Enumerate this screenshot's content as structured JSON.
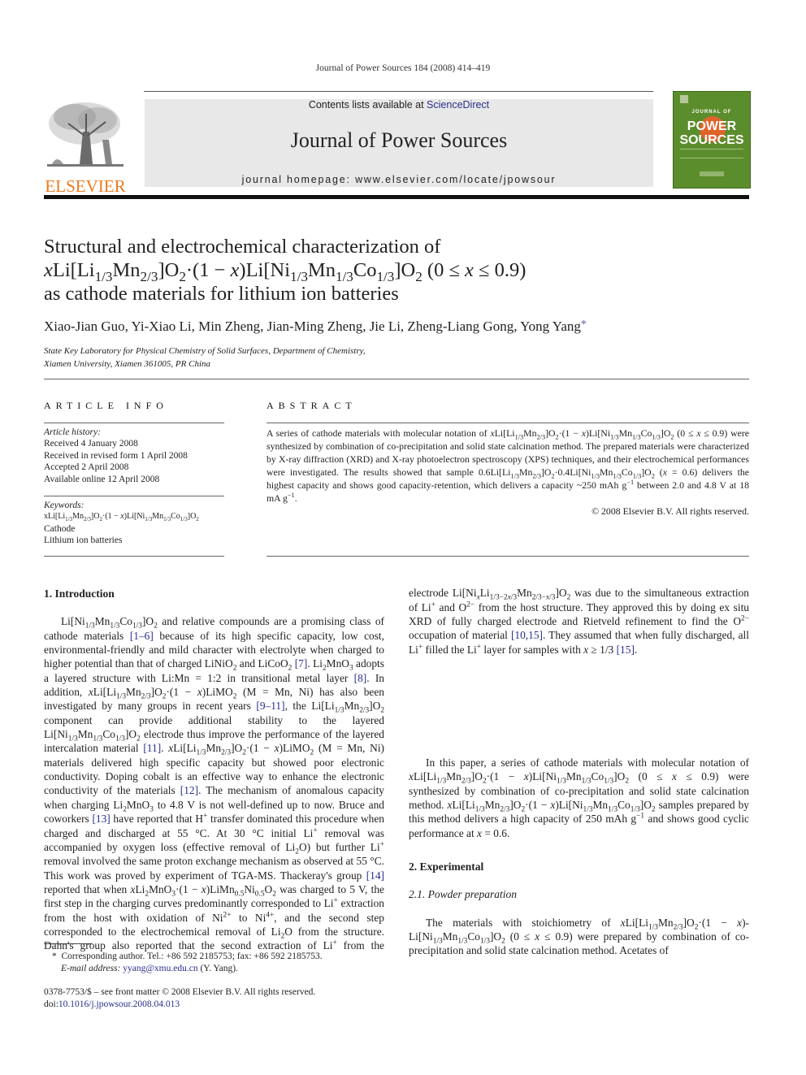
{
  "running_head": "Journal of Power Sources 184 (2008) 414–419",
  "header": {
    "publisher_logo_text": "ELSEVIER",
    "contents_prefix": "Contents lists available at ",
    "contents_link": "ScienceDirect",
    "journal_name": "Journal of Power Sources",
    "homepage_prefix": "journal homepage: ",
    "homepage_url": "www.elsevier.com/locate/jpowsour",
    "cover_small": "JOURNAL OF",
    "cover_big_1": "POWER",
    "cover_big_2": "SOURCES",
    "colors": {
      "elsevier_orange": "#f07a1e",
      "cover_green": "#5c8d2c",
      "cover_sun": "#e0632a",
      "banner_gray": "#e8e8e8",
      "link_blue": "#2a2f8c"
    }
  },
  "article": {
    "title_line1": "Structural and electrochemical characterization of",
    "title_line2_html": "<i>x</i>Li[Li<sub>1/3</sub>Mn<sub>2/3</sub>]O<sub>2</sub>·(1 − <i>x</i>)Li[Ni<sub>1/3</sub>Mn<sub>1/3</sub>Co<sub>1/3</sub>]O<sub>2</sub> (0 ≤ <i>x</i> ≤ 0.9)",
    "title_line3": "as cathode materials for lithium ion batteries",
    "authors": "Xiao-Jian Guo, Yi-Xiao Li, Min Zheng, Jian-Ming Zheng, Jie Li, Zheng-Liang Gong, Yong Yang",
    "corresponding_mark": "*",
    "affiliation_line1": "State Key Laboratory for Physical Chemistry of Solid Surfaces, Department of Chemistry,",
    "affiliation_line2": "Xiamen University, Xiamen 361005, PR China"
  },
  "article_info": {
    "heading": "ARTICLE INFO",
    "history_label": "Article history:",
    "history": [
      "Received 4 January 2008",
      "Received in revised form 1 April 2008",
      "Accepted 2 April 2008",
      "Available online 12 April 2008"
    ],
    "keywords_label": "Keywords:",
    "keywords_html": [
      "xLi[Li<sub>1/3</sub>Mn<sub>2/3</sub>]O<sub>2</sub>·(1 − <i>x</i>)Li[Ni<sub>1/3</sub>Mn<sub>1/3</sub>Co<sub>1/3</sub>]O<sub>2</sub>",
      "Cathode",
      "Lithium ion batteries"
    ]
  },
  "abstract": {
    "heading": "ABSTRACT",
    "body_html": "A series of cathode materials with molecular notation of <i>x</i>Li[Li<sub>1/3</sub>Mn<sub>2/3</sub>]O<sub>2</sub>·(1 − <i>x</i>)Li[Ni<sub>1/3</sub>Mn<sub>1/3</sub>Co<sub>1/3</sub>]O<sub>2</sub> (0 ≤ <i>x</i> ≤ 0.9) were synthesized by combination of co-precipitation and solid state calcination method. The prepared materials were characterized by X-ray diffraction (XRD) and X-ray photoelectron spectroscopy (XPS) techniques, and their electrochemical performances were investigated. The results showed that sample 0.6Li[Li<sub>1/3</sub>Mn<sub>2/3</sub>]O<sub>2</sub>·0.4Li[Ni<sub>1/3</sub>Mn<sub>1/3</sub>Co<sub>1/3</sub>]O<sub>2</sub> (<i>x</i> = 0.6) delivers the highest capacity and shows good capacity-retention, which delivers a capacity ~250 mAh g<sup>−1</sup> between 2.0 and 4.8 V at 18 mA g<sup>−1</sup>.",
    "copyright": "© 2008 Elsevier B.V. All rights reserved."
  },
  "sections": {
    "intro_heading": "1.  Introduction",
    "intro_p1_html": "Li[Ni<sub>1/3</sub>Mn<sub>1/3</sub>Co<sub>1/3</sub>]O<sub>2</sub> and relative compounds are a promising class of cathode materials <span class=\"link\">[1–6]</span> because of its high specific capacity, low cost, environmental-friendly and mild character with electrolyte when charged to higher potential than that of charged LiNiO<sub>2</sub> and LiCoO<sub>2</sub> <span class=\"link\">[7]</span>. Li<sub>2</sub>MnO<sub>3</sub> adopts a layered structure with Li:Mn = 1:2 in transitional metal layer <span class=\"link\">[8]</span>. In addition, <i>x</i>Li[Li<sub>1/3</sub>Mn<sub>2/3</sub>]O<sub>2</sub>·(1 − <i>x</i>)LiMO<sub>2</sub> (M = Mn, Ni) has also been investigated by many groups in recent years <span class=\"link\">[9–11]</span>, the Li[Li<sub>1/3</sub>Mn<sub>2/3</sub>]O<sub>2</sub> component can provide additional stability to the layered Li[Ni<sub>1/3</sub>Mn<sub>1/3</sub>Co<sub>1/3</sub>]O<sub>2</sub> electrode thus improve the performance of the layered intercalation material <span class=\"link\">[11]</span>. <i>x</i>Li[Li<sub>1/3</sub>Mn<sub>2/3</sub>]O<sub>2</sub>·(1 − <i>x</i>)LiMO<sub>2</sub> (M = Mn, Ni) materials delivered high specific capacity but showed poor electronic conductivity. Doping cobalt is an effective way to enhance the electronic conductivity of the materials <span class=\"link\">[12]</span>. The mechanism of anomalous capacity when charging Li<sub>2</sub>MnO<sub>3</sub> to 4.8 V is not well-defined up to now. Bruce and coworkers <span class=\"link\">[13]</span> have reported that H<sup>+</sup> transfer dominated this procedure when charged and discharged at 55 °C. At 30 °C initial Li<sup>+</sup> removal was accompanied by oxygen loss (effective removal of Li<sub>2</sub>O) but further Li<sup>+</sup> removal involved the same proton exchange mechanism as observed at 55 °C. This work was proved by experiment of TGA-MS. Thackeray's group <span class=\"link\">[14]</span> reported that when <i>x</i>Li<sub>2</sub>MnO<sub>3</sub>·(1 − <i>x</i>)LiMn<sub>0.5</sub>Ni<sub>0.5</sub>O<sub>2</sub> was charged to 5 V, the first step in the charging curves predominantly corresponded to Li<sup>+</sup> extraction from the host with oxidation of Ni<sup>2+</sup> to Ni<sup>4+</sup>, and the second step corresponded to the electrochemical removal of Li<sub>2</sub>O from the structure. Dahn's group also reported that the second extraction of Li<sup>+</sup> from the electrode Li[Ni<sub><i>x</i></sub>Li<sub>1/3−2<i>x</i>/3</sub>Mn<sub>2/3−<i>x</i>/3</sub>]O<sub>2</sub> was due to the simultaneous extraction of Li<sup>+</sup> and O<sup>2−</sup> from the host structure. They approved this by doing ex situ XRD of fully charged electrode and Rietveld refinement to find the O<sup>2−</sup> occupation of material <span class=\"link\">[10,15]</span>. They assumed that when fully discharged, all Li<sup>+</sup> filled the Li<sup>+</sup> layer for samples with <i>x</i> ≥ 1/3 <span class=\"link\">[15]</span>.",
    "intro_p2_html": "In this paper, a series of cathode materials with molecular notation of <i>x</i>Li[Li<sub>1/3</sub>Mn<sub>2/3</sub>]O<sub>2</sub>·(1 − <i>x</i>)Li[Ni<sub>1/3</sub>Mn<sub>1/3</sub>Co<sub>1/3</sub>]O<sub>2</sub> (0 ≤ <i>x</i> ≤ 0.9) were synthesized by combination of co-precipitation and solid state calcination method. <i>x</i>Li[Li<sub>1/3</sub>Mn<sub>2/3</sub>]O<sub>2</sub>·(1 − <i>x</i>)Li[Ni<sub>1/3</sub>Mn<sub>1/3</sub>Co<sub>1/3</sub>]O<sub>2</sub> samples prepared by this method delivers a high capacity of 250 mAh g<sup>−1</sup> and shows good cyclic performance at <i>x</i> = 0.6.",
    "exp_heading": "2.  Experimental",
    "exp_sub_heading": "2.1.  Powder preparation",
    "exp_p1_html": "The materials with stoichiometry of <i>x</i>Li[Li<sub>1/3</sub>Mn<sub>2/3</sub>]O<sub>2</sub>·(1 − <i>x</i>)-Li[Ni<sub>1/3</sub>Mn<sub>1/3</sub>Co<sub>1/3</sub>]O<sub>2</sub> (0 ≤ <i>x</i> ≤ 0.9) were prepared by combination of co-precipitation and solid state calcination method. Acetates of"
  },
  "footnote": {
    "mark": "*",
    "text": "Corresponding author. Tel.: +86 592 2185753; fax: +86 592 2185753.",
    "email_label": "E-mail address: ",
    "email": "yyang@xmu.edu.cn",
    "email_suffix": " (Y. Yang)."
  },
  "front_matter": {
    "issn_line": "0378-7753/$ – see front matter © 2008 Elsevier B.V. All rights reserved.",
    "doi_prefix": "doi:",
    "doi": "10.1016/j.jpowsour.2008.04.013"
  }
}
